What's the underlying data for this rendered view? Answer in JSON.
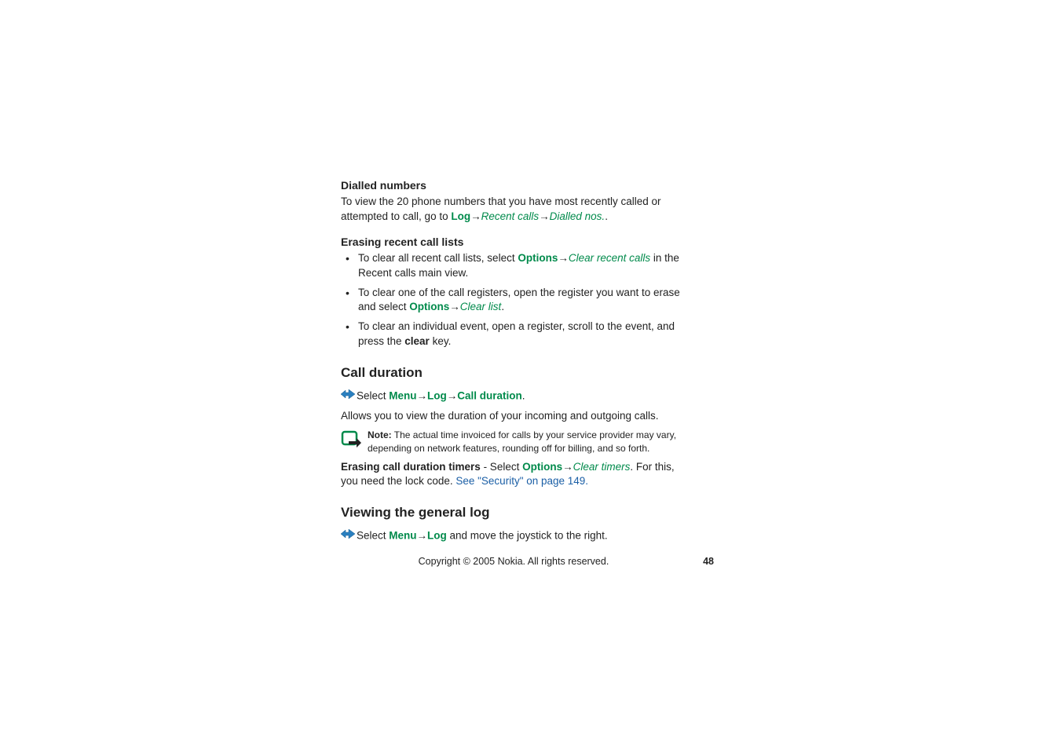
{
  "dialled": {
    "heading": "Dialled numbers",
    "intro_part1": "To view the 20 phone numbers that you have most recently called or attempted to call, go to ",
    "log": "Log",
    "recent_calls": "Recent calls",
    "dialled_nos": "Dialled nos.",
    "period": "."
  },
  "erasing": {
    "heading": "Erasing recent call lists",
    "item1_pre": "To clear all recent call lists, select ",
    "item1_options": "Options",
    "item1_clear_recent": "Clear recent calls",
    "item1_post": " in the Recent calls main view.",
    "item2_pre": "To clear one of the call registers, open the register you want to erase and select ",
    "item2_options": "Options",
    "item2_clear_list": "Clear list",
    "item2_post": ".",
    "item3_pre": "To clear an individual event, open a register, scroll to the event, and press the ",
    "item3_clear": "clear",
    "item3_post": " key."
  },
  "call_duration": {
    "heading": "Call duration",
    "select": "Select ",
    "menu": "Menu",
    "log": "Log",
    "call_duration": "Call duration",
    "period": ".",
    "allows": "Allows you to view the duration of your incoming and outgoing calls.",
    "note_bold": "Note:",
    "note_text": " The actual time invoiced for calls by your service provider may vary, depending on network features, rounding off for billing, and so forth.",
    "erasing_bold": "Erasing call duration timers",
    "erasing_mid": " - Select ",
    "erasing_options": "Options",
    "erasing_clear_timers": "Clear timers",
    "erasing_post": ". For this, you need the lock code. ",
    "erasing_link": "See \"Security\" on page 149."
  },
  "viewing": {
    "heading": "Viewing the general log",
    "select": "Select ",
    "menu": "Menu",
    "log": "Log",
    "post": " and move the joystick to the right."
  },
  "footer": {
    "copyright": "Copyright © 2005 Nokia. All rights reserved.",
    "page": "48"
  },
  "arrow": "→"
}
